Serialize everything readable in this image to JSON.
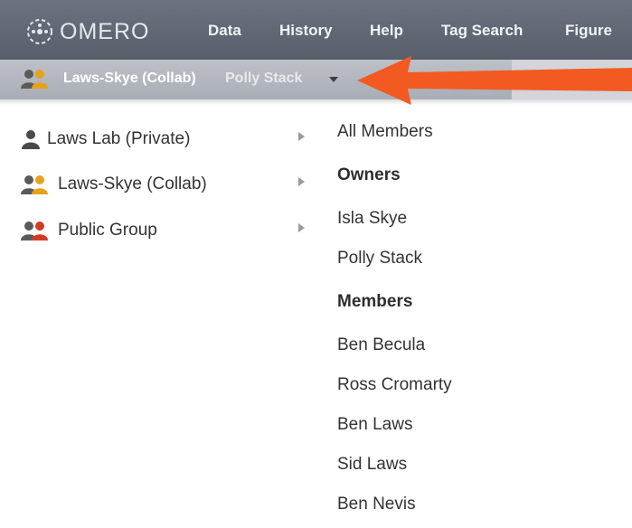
{
  "app": {
    "logo_text": "OMERO",
    "nav": [
      {
        "label": "Data"
      },
      {
        "label": "History"
      },
      {
        "label": "Help"
      },
      {
        "label": "Tag Search"
      },
      {
        "label": "Figure"
      }
    ]
  },
  "context_bar": {
    "group_name": "Laws-Skye (Collab)",
    "user_name": "Polly Stack",
    "accent_color": "#f25a22"
  },
  "groups": [
    {
      "label": "Laws Lab (Private)",
      "icon": "private-group-icon",
      "color": "#4a4a4a"
    },
    {
      "label": "Laws-Skye (Collab)",
      "icon": "collab-group-icon",
      "color": "#e8a21a"
    },
    {
      "label": "Public Group",
      "icon": "public-group-icon",
      "color": "#d33a22"
    }
  ],
  "members": {
    "all_label": "All Members",
    "owners_header": "Owners",
    "owners": [
      "Isla Skye",
      "Polly Stack"
    ],
    "members_header": "Members",
    "members": [
      "Ben Becula",
      "Ross Cromarty",
      "Ben Laws",
      "Sid Laws",
      "Ben Nevis"
    ]
  }
}
